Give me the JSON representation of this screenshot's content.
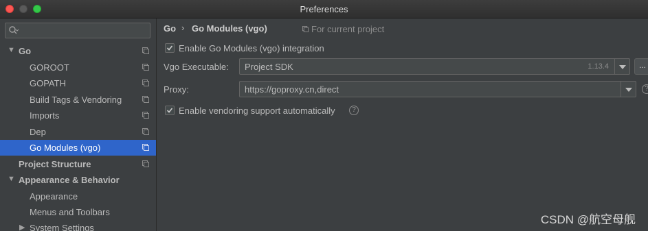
{
  "window": {
    "title": "Preferences"
  },
  "sidebar": {
    "search": {
      "value": "",
      "placeholder": ""
    },
    "items": [
      {
        "label": "Go",
        "expanded": true
      },
      {
        "label": "GOROOT"
      },
      {
        "label": "GOPATH"
      },
      {
        "label": "Build Tags & Vendoring"
      },
      {
        "label": "Imports"
      },
      {
        "label": "Dep"
      },
      {
        "label": "Go Modules (vgo)",
        "selected": true
      },
      {
        "label": "Project Structure"
      },
      {
        "label": "Appearance & Behavior",
        "expanded": true
      },
      {
        "label": "Appearance"
      },
      {
        "label": "Menus and Toolbars"
      },
      {
        "label": "System Settings",
        "expanded": false
      }
    ]
  },
  "main": {
    "breadcrumb": {
      "parent": "Go",
      "separator": "›",
      "current": "Go Modules (vgo)"
    },
    "scope_note": "For current project",
    "enable_modules": {
      "label": "Enable Go Modules (vgo) integration",
      "checked": true
    },
    "vgo_executable": {
      "label": "Vgo Executable:",
      "value": "Project SDK",
      "version": "1.13.4",
      "browse_label": "..."
    },
    "proxy": {
      "label": "Proxy:",
      "value": "https://goproxy.cn,direct"
    },
    "vendoring": {
      "label": "Enable vendoring support automatically",
      "checked": true
    },
    "help_glyph": "?"
  },
  "watermark": "CSDN @航空母舰",
  "colors": {
    "selection": "#2f65ca",
    "background": "#3c3f41",
    "field": "#45494a"
  }
}
